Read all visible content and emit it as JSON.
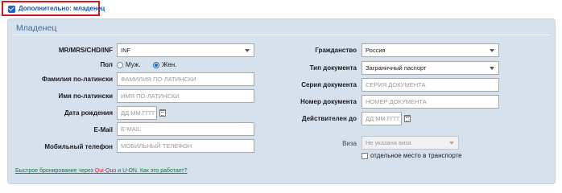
{
  "toggle": {
    "label": "Дополнительно: младенец",
    "checked": true,
    "check_color": "#1f64c8",
    "highlight_color": "#d9141d"
  },
  "panel": {
    "title": "Младенец",
    "background": "#d6e1ee"
  },
  "form_left": {
    "title_label": "MR/MRS/CHD/INF",
    "title_value": "INF",
    "gender_label": "Пол",
    "gender_options": [
      {
        "label": "Муж.",
        "selected": false
      },
      {
        "label": "Жен.",
        "selected": true
      }
    ],
    "lastname_label": "Фамилия по-латински",
    "lastname_placeholder": "ФАМИЛИЯ ПО-ЛАТИНСКИ",
    "firstname_label": "Имя по-латински",
    "firstname_placeholder": "ИМЯ ПО-ЛАТИНСКИ",
    "birthdate_label": "Дата рождения",
    "birthdate_placeholder": "ДД.ММ.ГГГГ",
    "email_label": "E-Mail",
    "email_placeholder": "E-MAIL",
    "phone_label": "Мобильный телефон",
    "phone_placeholder": "МОБИЛЬНЫЙ ТЕЛЕФОН"
  },
  "form_right": {
    "citizenship_label": "Гражданство",
    "citizenship_value": "Россия",
    "doctype_label": "Тип документа",
    "doctype_value": "Заграничный паспорт",
    "docseries_label": "Серия документа",
    "docseries_placeholder": "СЕРИЯ ДОКУМЕНТА",
    "docnumber_label": "Номер документа",
    "docnumber_placeholder": "НОМЕР ДОКУМЕНТА",
    "validuntil_label": "Действителен до",
    "validuntil_placeholder": "ДД.ММ.ГГГГ",
    "visa_label": "Виза",
    "visa_value": "Не указана виза",
    "separate_seat_label": "отдельное место в транспорте",
    "separate_seat_checked": false
  },
  "footer": {
    "link_prefix": "Быстрое бронирование через ",
    "brand_1": "Qui-Quo",
    "link_middle": " и U-ON. Как это работает?"
  },
  "icons": {
    "calendar": "calendar-icon",
    "dropdown": "chevron-down-icon"
  }
}
